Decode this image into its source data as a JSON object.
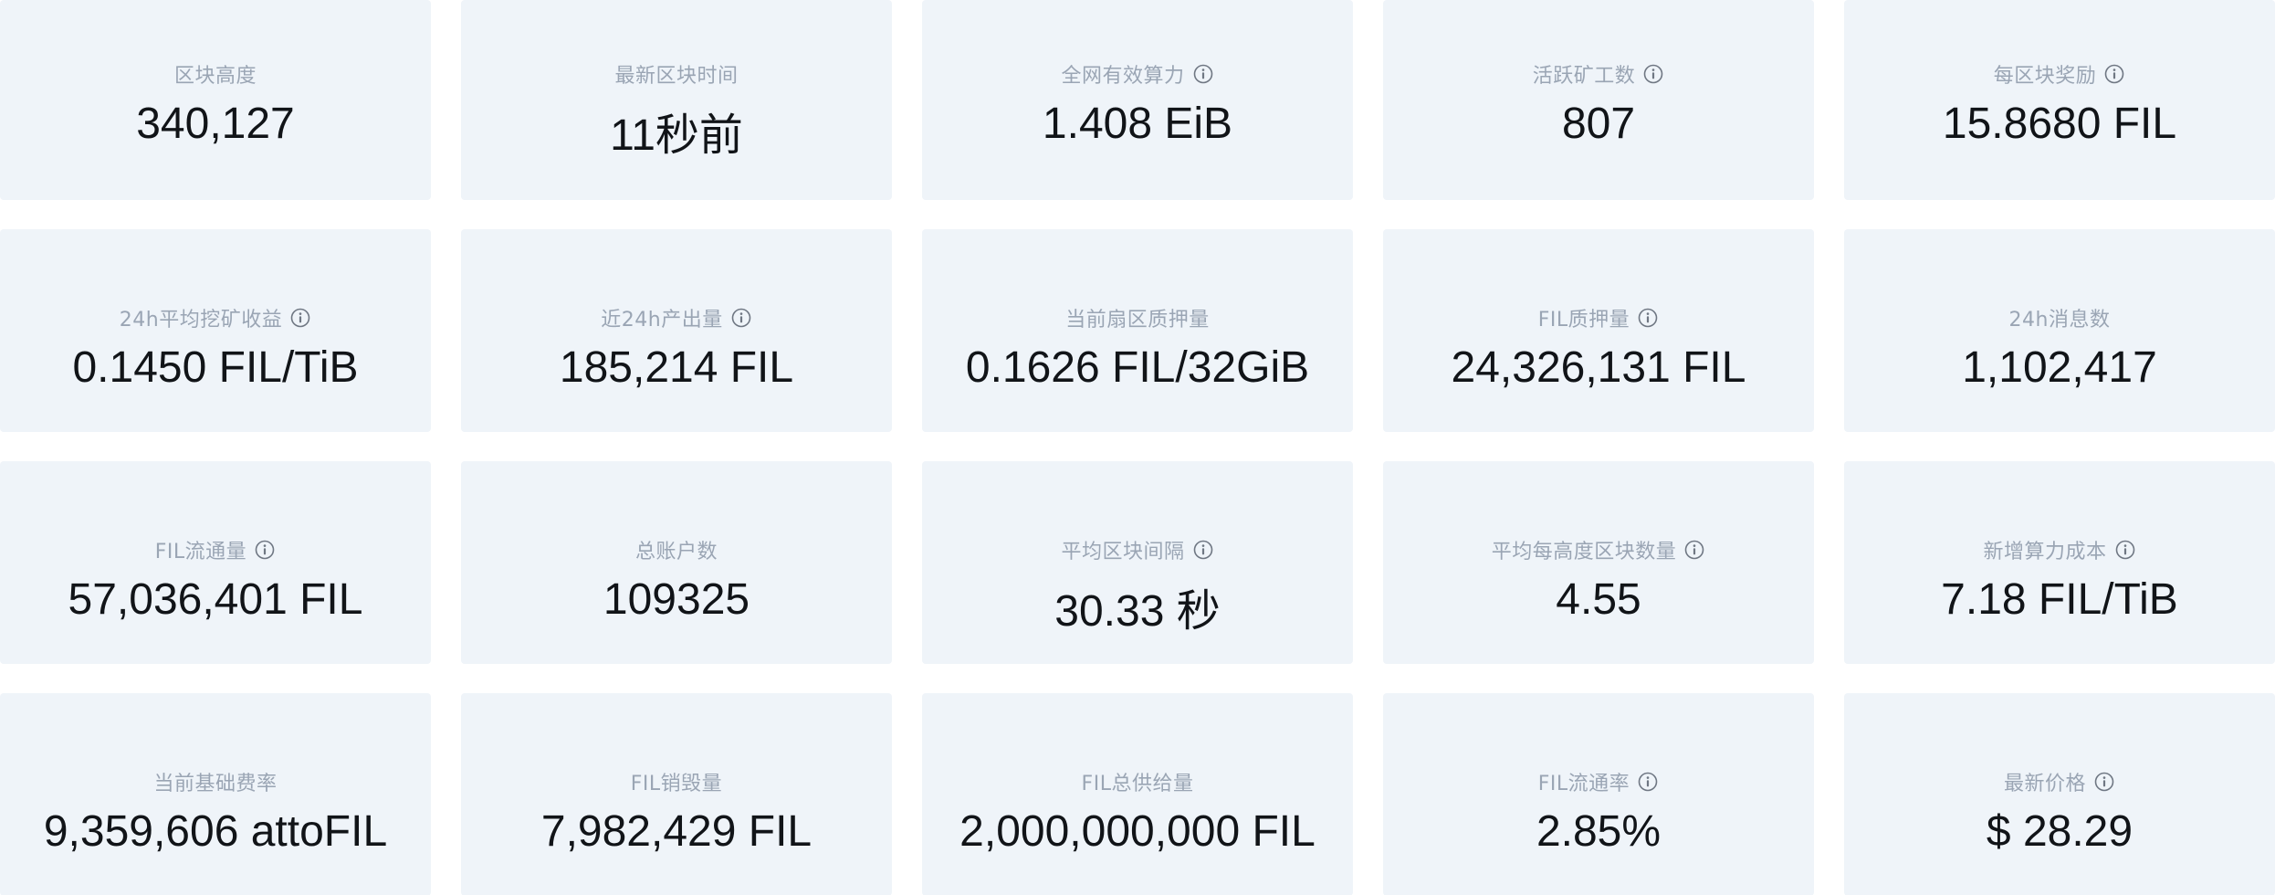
{
  "stats": [
    {
      "label": "区块高度",
      "value": "340,127",
      "info": false
    },
    {
      "label": "最新区块时间",
      "value": "11秒前",
      "info": false
    },
    {
      "label": "全网有效算力",
      "value": "1.408 EiB",
      "info": true
    },
    {
      "label": "活跃矿工数",
      "value": "807",
      "info": true
    },
    {
      "label": "每区块奖励",
      "value": "15.8680 FIL",
      "info": true
    },
    {
      "label": "24h平均挖矿收益",
      "value": "0.1450 FIL/TiB",
      "info": true
    },
    {
      "label": "近24h产出量",
      "value": "185,214 FIL",
      "info": true
    },
    {
      "label": "当前扇区质押量",
      "value": "0.1626 FIL/32GiB",
      "info": false
    },
    {
      "label": "FIL质押量",
      "value": "24,326,131 FIL",
      "info": true
    },
    {
      "label": "24h消息数",
      "value": "1,102,417",
      "info": false
    },
    {
      "label": "FIL流通量",
      "value": "57,036,401 FIL",
      "info": true
    },
    {
      "label": "总账户数",
      "value": "109325",
      "info": false
    },
    {
      "label": "平均区块间隔",
      "value": "30.33 秒",
      "info": true
    },
    {
      "label": "平均每高度区块数量",
      "value": "4.55",
      "info": true
    },
    {
      "label": "新增算力成本",
      "value": "7.18 FIL/TiB",
      "info": true
    },
    {
      "label": "当前基础费率",
      "value": "9,359,606 attoFIL",
      "info": false
    },
    {
      "label": "FIL销毁量",
      "value": "7,982,429 FIL",
      "info": false
    },
    {
      "label": "FIL总供给量",
      "value": "2,000,000,000 FIL",
      "info": false
    },
    {
      "label": "FIL流通率",
      "value": "2.85%",
      "info": true
    },
    {
      "label": "最新价格",
      "value": "$ 28.29",
      "info": true
    }
  ],
  "icons": {
    "info": "info-circle-icon"
  },
  "colors": {
    "card_bg": "#eff4f9",
    "label": "#9aa5b4",
    "value": "#111418"
  }
}
